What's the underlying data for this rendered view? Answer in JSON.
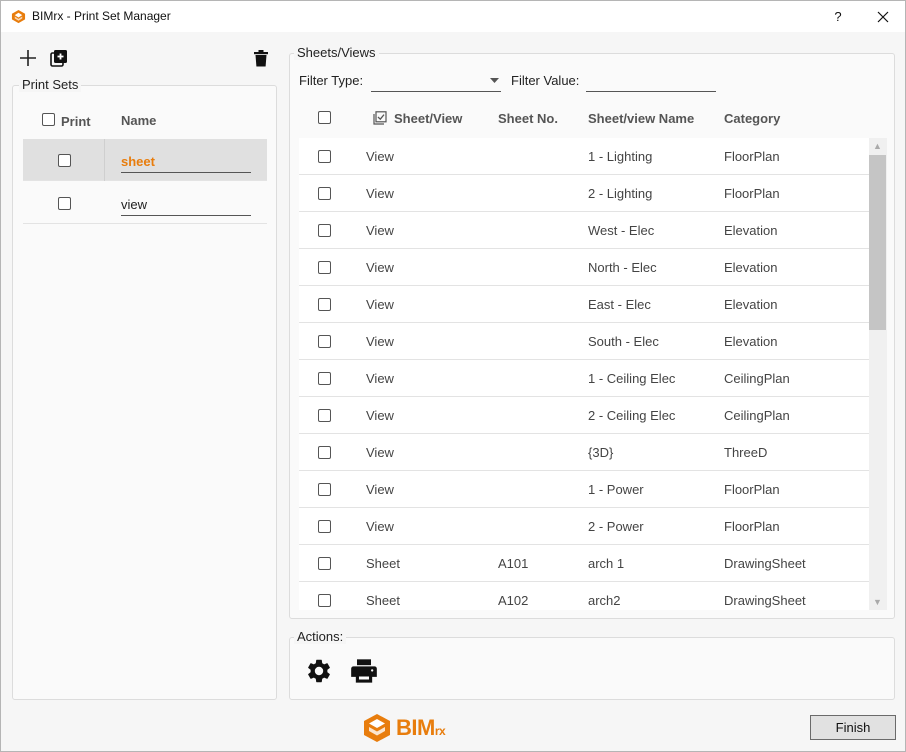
{
  "window": {
    "title": "BIMrx - Print Set Manager",
    "help_label": "?"
  },
  "print_sets": {
    "group_label": "Print Sets",
    "header": {
      "print": "Print",
      "name": "Name"
    },
    "items": [
      {
        "name": "sheet",
        "checked": false,
        "selected": true
      },
      {
        "name": "view",
        "checked": false,
        "selected": false
      }
    ]
  },
  "sheets": {
    "group_label": "Sheets/Views",
    "filter_type_label": "Filter Type:",
    "filter_type_value": "",
    "filter_value_label": "Filter Value:",
    "filter_value_value": "",
    "columns": [
      "Sheet/View",
      "Sheet No.",
      "Sheet/view Name",
      "Category"
    ],
    "rows": [
      {
        "type": "View",
        "number": "",
        "name": "1 - Lighting",
        "category": "FloorPlan"
      },
      {
        "type": "View",
        "number": "",
        "name": "2 - Lighting",
        "category": "FloorPlan"
      },
      {
        "type": "View",
        "number": "",
        "name": "West - Elec",
        "category": "Elevation"
      },
      {
        "type": "View",
        "number": "",
        "name": "North - Elec",
        "category": "Elevation"
      },
      {
        "type": "View",
        "number": "",
        "name": "East - Elec",
        "category": "Elevation"
      },
      {
        "type": "View",
        "number": "",
        "name": "South - Elec",
        "category": "Elevation"
      },
      {
        "type": "View",
        "number": "",
        "name": "1 - Ceiling Elec",
        "category": "CeilingPlan"
      },
      {
        "type": "View",
        "number": "",
        "name": "2 - Ceiling Elec",
        "category": "CeilingPlan"
      },
      {
        "type": "View",
        "number": "",
        "name": "{3D}",
        "category": "ThreeD"
      },
      {
        "type": "View",
        "number": "",
        "name": "1 - Power",
        "category": "FloorPlan"
      },
      {
        "type": "View",
        "number": "",
        "name": "2 - Power",
        "category": "FloorPlan"
      },
      {
        "type": "Sheet",
        "number": "A101",
        "name": "arch 1",
        "category": "DrawingSheet"
      },
      {
        "type": "Sheet",
        "number": "A102",
        "name": "arch2",
        "category": "DrawingSheet"
      }
    ]
  },
  "actions": {
    "group_label": "Actions:"
  },
  "footer": {
    "logo_main": "BIM",
    "logo_suffix": "rx",
    "finish_label": "Finish"
  },
  "colors": {
    "accent": "#e87d0d",
    "selected_row": "#e0e0e0",
    "scroll_thumb": "#c5c5c5"
  },
  "icons": {
    "add": "plus-icon",
    "duplicate": "duplicate-icon",
    "delete": "trash-icon",
    "settings": "gear-icon",
    "print": "printer-icon",
    "close": "close-icon"
  }
}
